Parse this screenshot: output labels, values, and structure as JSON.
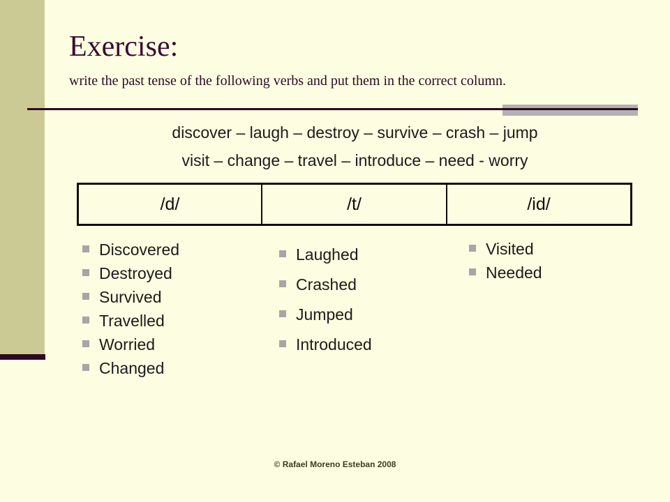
{
  "slide": {
    "title": "Exercise:",
    "subtitle": "write the past tense of the following verbs and put them in the correct column.",
    "verb_prompt": {
      "line1": "discover – laugh – destroy – survive – crash – jump",
      "line2": "visit – change – travel – introduce – need - worry"
    },
    "table": {
      "headers": [
        "/d/",
        "/t/",
        "/id/"
      ]
    },
    "answers": {
      "d_column": [
        "Discovered",
        "Destroyed",
        "Survived",
        "Travelled",
        "Worried",
        "Changed"
      ],
      "t_column": [
        "Laughed",
        "Crashed",
        "Jumped",
        "Introduced"
      ],
      "id_column": [
        "Visited",
        "Needed"
      ]
    },
    "footer": "© Rafael Moreno Esteban 2008",
    "colors": {
      "background": "#fdfde1",
      "band": "#ccca94",
      "accent_dark": "#2d0a26",
      "title": "#3a0b33",
      "grey_block": "#b2b2b2",
      "bullet": "#a6a6a6",
      "text": "#1b1b1b"
    }
  }
}
